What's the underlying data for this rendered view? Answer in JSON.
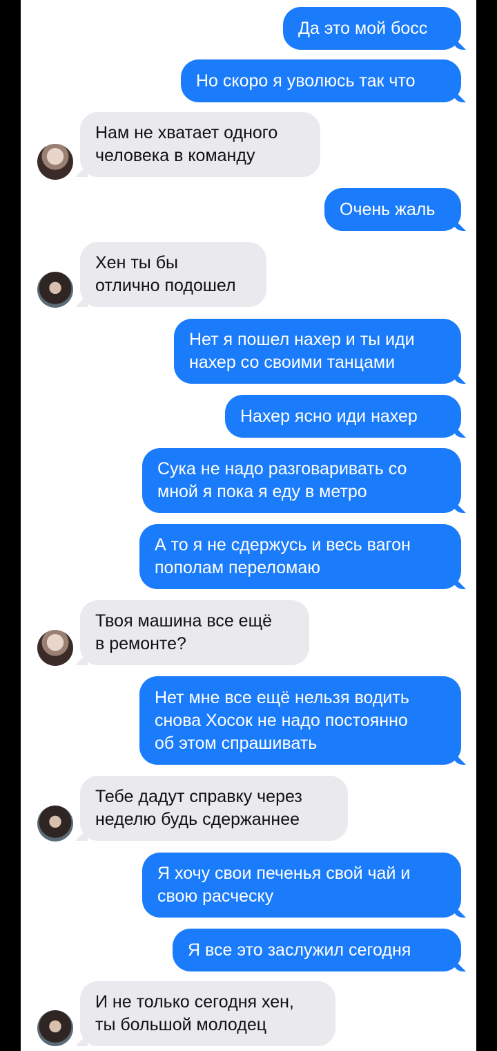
{
  "messages": [
    {
      "side": "out",
      "lines": [
        "Да это мой босс"
      ]
    },
    {
      "side": "out",
      "lines": [
        "Но скоро я уволюсь так что"
      ]
    },
    {
      "side": "in",
      "avatar": "avatar-a",
      "lines": [
        "Нам не хватает одного",
        "человека в команду"
      ]
    },
    {
      "side": "out",
      "lines": [
        "Очень жаль"
      ]
    },
    {
      "side": "in",
      "avatar": "avatar-b",
      "lines": [
        "Хен ты бы",
        "отлично подошел"
      ]
    },
    {
      "side": "out",
      "lines": [
        "Нет я пошел нахер и ты иди",
        "нахер со своими танцами"
      ]
    },
    {
      "side": "out",
      "lines": [
        "Нахер ясно иди нахер"
      ]
    },
    {
      "side": "out",
      "lines": [
        "Сука не надо разговаривать со",
        "мной я пока я еду в метро"
      ]
    },
    {
      "side": "out",
      "lines": [
        "А то я не сдержусь и весь вагон",
        "пополам переломаю"
      ]
    },
    {
      "side": "in",
      "avatar": "avatar-a",
      "lines": [
        "Твоя машина все ещё",
        "в ремонте?"
      ]
    },
    {
      "side": "out",
      "lines": [
        "Нет мне все ещё нельзя водить",
        "снова Хосок не надо постоянно",
        "об этом спрашивать"
      ]
    },
    {
      "side": "in",
      "avatar": "avatar-b",
      "lines": [
        "Тебе дадут справку через",
        "неделю будь сдержаннее"
      ]
    },
    {
      "side": "out",
      "lines": [
        "Я хочу свои печенья свой чай и",
        "свою расческу"
      ]
    },
    {
      "side": "out",
      "lines": [
        "Я все это заслужил сегодня"
      ]
    },
    {
      "side": "in",
      "avatar": "avatar-b",
      "lines": [
        "И не только сегодня хен,",
        "ты большой молодец"
      ]
    }
  ],
  "colors": {
    "outgoing_bubble": "#1a7bfb",
    "incoming_bubble": "#e9e9ee",
    "background": "#ffffff"
  }
}
